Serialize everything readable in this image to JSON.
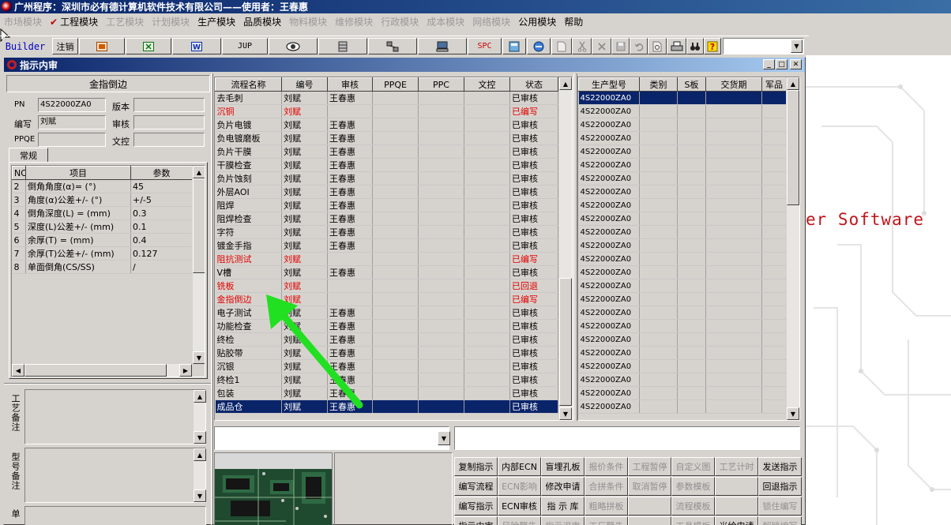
{
  "app": {
    "title": "广州程序：深圳市必有德计算机软件技术有限公司——使用者：王春惠"
  },
  "menu": [
    {
      "label": "市场模块",
      "enabled": false
    },
    {
      "label": "工程模块",
      "enabled": true,
      "checked": true
    },
    {
      "label": "工艺模块",
      "enabled": false
    },
    {
      "label": "计划模块",
      "enabled": false
    },
    {
      "label": "生产模块",
      "enabled": true
    },
    {
      "label": "品质模块",
      "enabled": true
    },
    {
      "label": "物料模块",
      "enabled": false
    },
    {
      "label": "维修模块",
      "enabled": false
    },
    {
      "label": "行政模块",
      "enabled": false
    },
    {
      "label": "成本模块",
      "enabled": false
    },
    {
      "label": "网络模块",
      "enabled": false
    },
    {
      "label": "公用模块",
      "enabled": true
    },
    {
      "label": "帮助",
      "enabled": true
    }
  ],
  "toolbar": {
    "builder_label": "Builder",
    "logout_label": "注销",
    "jup_label": "JUP",
    "spc_label": "SPC"
  },
  "background": {
    "text": "er Software"
  },
  "window": {
    "title": "指示内审"
  },
  "left": {
    "title": "金指倒边",
    "pn_label": "PN",
    "pn_value": "4S22000ZA0",
    "version_label": "版本",
    "version_value": "",
    "writer_label": "编写",
    "writer_value": "刘赋",
    "review_label": "审核",
    "review_value": "",
    "ppqe_label": "PPQE",
    "ppqe_value": "",
    "doc_label": "文控",
    "doc_value": "",
    "tab_label": "常规",
    "param_headers": [
      "NO",
      "项目",
      "参数"
    ],
    "params": [
      {
        "no": "2",
        "item": "倒角角度(α)=  (°)",
        "value": "45"
      },
      {
        "no": "3",
        "item": "角度(α)公差+/-  (°)",
        "value": "+/-5"
      },
      {
        "no": "4",
        "item": "倒角深度(L) =  (mm)",
        "value": "0.3"
      },
      {
        "no": "5",
        "item": "深度(L)公差+/-  (mm)",
        "value": "0.1"
      },
      {
        "no": "6",
        "item": "余厚(T) =  (mm)",
        "value": "0.4"
      },
      {
        "no": "7",
        "item": "余厚(T)公差+/-  (mm)",
        "value": "0.127"
      },
      {
        "no": "8",
        "item": "单面倒角(CS/SS)",
        "value": "/"
      }
    ],
    "process_note_label": "工艺备注",
    "model_note_label": "型号备注",
    "order_note_label": "订单"
  },
  "process": {
    "headers": [
      "流程名称",
      "编号",
      "审核",
      "PPQE",
      "PPC",
      "文控",
      "状态"
    ],
    "rows": [
      {
        "name": "去毛刺",
        "code": "刘赋",
        "review": "王春惠",
        "status": "已审核",
        "red": false
      },
      {
        "name": "沉铜",
        "code": "刘赋",
        "review": "",
        "status": "已编写",
        "red": true
      },
      {
        "name": "负片电镀",
        "code": "刘赋",
        "review": "王春惠",
        "status": "已审核",
        "red": false
      },
      {
        "name": "负电镀磨板",
        "code": "刘赋",
        "review": "王春惠",
        "status": "已审核",
        "red": false
      },
      {
        "name": "负片干膜",
        "code": "刘赋",
        "review": "王春惠",
        "status": "已审核",
        "red": false
      },
      {
        "name": "干膜检查",
        "code": "刘赋",
        "review": "王春惠",
        "status": "已审核",
        "red": false
      },
      {
        "name": "负片蚀刻",
        "code": "刘赋",
        "review": "王春惠",
        "status": "已审核",
        "red": false
      },
      {
        "name": "外层AOI",
        "code": "刘赋",
        "review": "王春惠",
        "status": "已审核",
        "red": false
      },
      {
        "name": "阻焊",
        "code": "刘赋",
        "review": "王春惠",
        "status": "已审核",
        "red": false
      },
      {
        "name": "阻焊检查",
        "code": "刘赋",
        "review": "王春惠",
        "status": "已审核",
        "red": false
      },
      {
        "name": "字符",
        "code": "刘赋",
        "review": "王春惠",
        "status": "已审核",
        "red": false
      },
      {
        "name": "镀金手指",
        "code": "刘赋",
        "review": "王春惠",
        "status": "已审核",
        "red": false
      },
      {
        "name": "阻抗测试",
        "code": "刘赋",
        "review": "",
        "status": "已编写",
        "red": true
      },
      {
        "name": "V槽",
        "code": "刘赋",
        "review": "王春惠",
        "status": "已审核",
        "red": false
      },
      {
        "name": "铣板",
        "code": "刘赋",
        "review": "",
        "status": "已回退",
        "red": true
      },
      {
        "name": "金指倒边",
        "code": "刘赋",
        "review": "",
        "status": "已编写",
        "red": true
      },
      {
        "name": "电子测试",
        "code": "刘赋",
        "review": "王春惠",
        "status": "已审核",
        "red": false
      },
      {
        "name": "功能检查",
        "code": "刘赋",
        "review": "王春惠",
        "status": "已审核",
        "red": false
      },
      {
        "name": "终检",
        "code": "刘赋",
        "review": "王春惠",
        "status": "已审核",
        "red": false
      },
      {
        "name": "贴胶带",
        "code": "刘赋",
        "review": "王春惠",
        "status": "已审核",
        "red": false
      },
      {
        "name": "沉银",
        "code": "刘赋",
        "review": "王春惠",
        "status": "已审核",
        "red": false
      },
      {
        "name": "终检1",
        "code": "刘赋",
        "review": "王春惠",
        "status": "已审核",
        "red": false
      },
      {
        "name": "包装",
        "code": "刘赋",
        "review": "王春惠",
        "status": "已审核",
        "red": false
      },
      {
        "name": "成品仓",
        "code": "刘赋",
        "review": "王春惠",
        "status": "已审核",
        "red": false,
        "selected": true
      }
    ]
  },
  "models": {
    "headers": [
      "生产型号",
      "类别",
      "S板",
      "交货期",
      "军品"
    ],
    "rows": [
      "4S22000ZA0",
      "4S22000ZA0",
      "4S22000ZA0",
      "4S22000ZA0",
      "4S22000ZA0",
      "4S22000ZA0",
      "4S22000ZA0",
      "4S22000ZA0",
      "4S22000ZA0",
      "4S22000ZA0",
      "4S22000ZA0",
      "4S22000ZA0",
      "4S22000ZA0",
      "4S22000ZA0",
      "4S22000ZA0",
      "4S22000ZA0",
      "4S22000ZA0",
      "4S22000ZA0",
      "4S22000ZA0",
      "4S22000ZA0",
      "4S22000ZA0",
      "4S22000ZA0",
      "4S22000ZA0",
      "4S22000ZA0"
    ]
  },
  "commands": [
    [
      {
        "label": "复制指示",
        "enabled": true
      },
      {
        "label": "内部ECN",
        "enabled": true
      },
      {
        "label": "盲埋孔板",
        "enabled": true
      },
      {
        "label": "报价条件",
        "enabled": false
      },
      {
        "label": "工程暂停",
        "enabled": false
      },
      {
        "label": "自定义图",
        "enabled": false
      },
      {
        "label": "工艺计时",
        "enabled": false
      },
      {
        "label": "发送指示",
        "enabled": true
      }
    ],
    [
      {
        "label": "编写流程",
        "enabled": true
      },
      {
        "label": "ECN影响",
        "enabled": false
      },
      {
        "label": "修改申请",
        "enabled": true
      },
      {
        "label": "合拼条件",
        "enabled": false
      },
      {
        "label": "取消暂停",
        "enabled": false
      },
      {
        "label": "参数模板",
        "enabled": false
      },
      {
        "label": "",
        "enabled": false
      },
      {
        "label": "回退指示",
        "enabled": true
      }
    ],
    [
      {
        "label": "编写指示",
        "enabled": true
      },
      {
        "label": "ECN审核",
        "enabled": true
      },
      {
        "label": "指 示 库",
        "enabled": true
      },
      {
        "label": "粗略拼板",
        "enabled": false
      },
      {
        "label": "",
        "enabled": false
      },
      {
        "label": "流程模板",
        "enabled": false
      },
      {
        "label": "",
        "enabled": false
      },
      {
        "label": "锁住编写",
        "enabled": false
      }
    ],
    [
      {
        "label": "指示内审",
        "enabled": true
      },
      {
        "label": "风险警告",
        "enabled": false
      },
      {
        "label": "指示退审",
        "enabled": false
      },
      {
        "label": "工厂警告",
        "enabled": false
      },
      {
        "label": "",
        "enabled": false
      },
      {
        "label": "工具模板",
        "enabled": false
      },
      {
        "label": "光绘申请",
        "enabled": true
      },
      {
        "label": "解锁编写",
        "enabled": false
      }
    ]
  ],
  "colors": {
    "selection": "#0a246a",
    "red_status": "#e00000",
    "arrow": "#21e021",
    "titlebar": "#0a246a"
  }
}
